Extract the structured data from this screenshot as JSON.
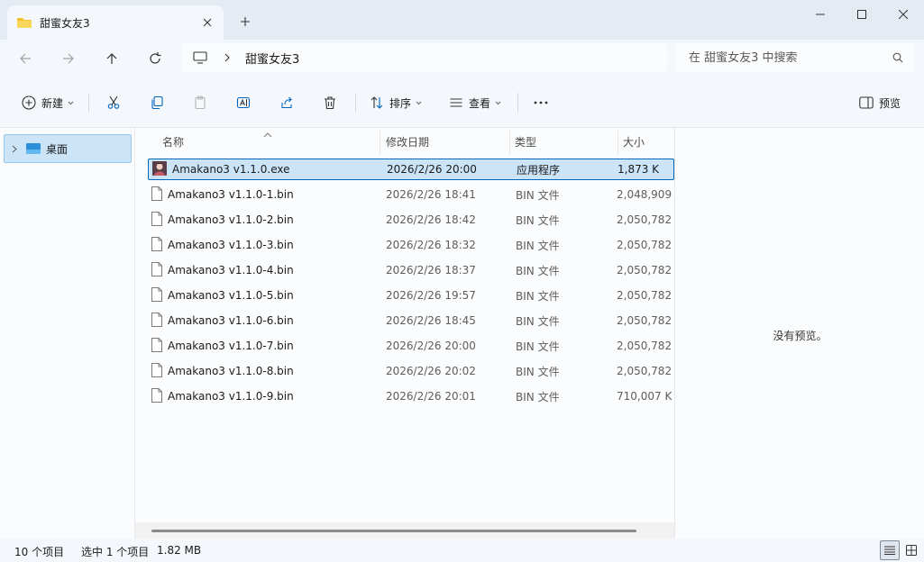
{
  "window": {
    "tab_title": "甜蜜女友3",
    "new_tab": "+"
  },
  "address": {
    "crumb": "甜蜜女友3",
    "search_placeholder": "在 甜蜜女友3 中搜索"
  },
  "toolbar": {
    "new_label": "新建",
    "sort_label": "排序",
    "view_label": "查看",
    "more_label": "···",
    "preview_label": "预览"
  },
  "sidebar": {
    "items": [
      {
        "label": "桌面"
      }
    ]
  },
  "columns": {
    "name": "名称",
    "date": "修改日期",
    "type": "类型",
    "size": "大小"
  },
  "files": [
    {
      "name": "Amakano3 v1.1.0.exe",
      "date": "2026/2/26 20:00",
      "type": "应用程序",
      "size": "1,873 K",
      "icon": "app-icon",
      "selected": true
    },
    {
      "name": "Amakano3 v1.1.0-1.bin",
      "date": "2026/2/26 18:41",
      "type": "BIN 文件",
      "size": "2,048,909",
      "icon": "file-icon"
    },
    {
      "name": "Amakano3 v1.1.0-2.bin",
      "date": "2026/2/26 18:42",
      "type": "BIN 文件",
      "size": "2,050,782",
      "icon": "file-icon"
    },
    {
      "name": "Amakano3 v1.1.0-3.bin",
      "date": "2026/2/26 18:32",
      "type": "BIN 文件",
      "size": "2,050,782",
      "icon": "file-icon"
    },
    {
      "name": "Amakano3 v1.1.0-4.bin",
      "date": "2026/2/26 18:37",
      "type": "BIN 文件",
      "size": "2,050,782",
      "icon": "file-icon"
    },
    {
      "name": "Amakano3 v1.1.0-5.bin",
      "date": "2026/2/26 19:57",
      "type": "BIN 文件",
      "size": "2,050,782",
      "icon": "file-icon"
    },
    {
      "name": "Amakano3 v1.1.0-6.bin",
      "date": "2026/2/26 18:45",
      "type": "BIN 文件",
      "size": "2,050,782",
      "icon": "file-icon"
    },
    {
      "name": "Amakano3 v1.1.0-7.bin",
      "date": "2026/2/26 20:00",
      "type": "BIN 文件",
      "size": "2,050,782",
      "icon": "file-icon"
    },
    {
      "name": "Amakano3 v1.1.0-8.bin",
      "date": "2026/2/26 20:02",
      "type": "BIN 文件",
      "size": "2,050,782",
      "icon": "file-icon"
    },
    {
      "name": "Amakano3 v1.1.0-9.bin",
      "date": "2026/2/26 20:01",
      "type": "BIN 文件",
      "size": "710,007 K",
      "icon": "file-icon"
    }
  ],
  "preview": {
    "empty_text": "没有预览。"
  },
  "status": {
    "item_count": "10 个项目",
    "selection": "选中 1 个项目",
    "selection_size": "1.82 MB"
  },
  "colors": {
    "selection_bg": "#cce4f7",
    "selection_border": "#0067c0",
    "folder": "#f3c12d",
    "accent": "#0067c0"
  }
}
